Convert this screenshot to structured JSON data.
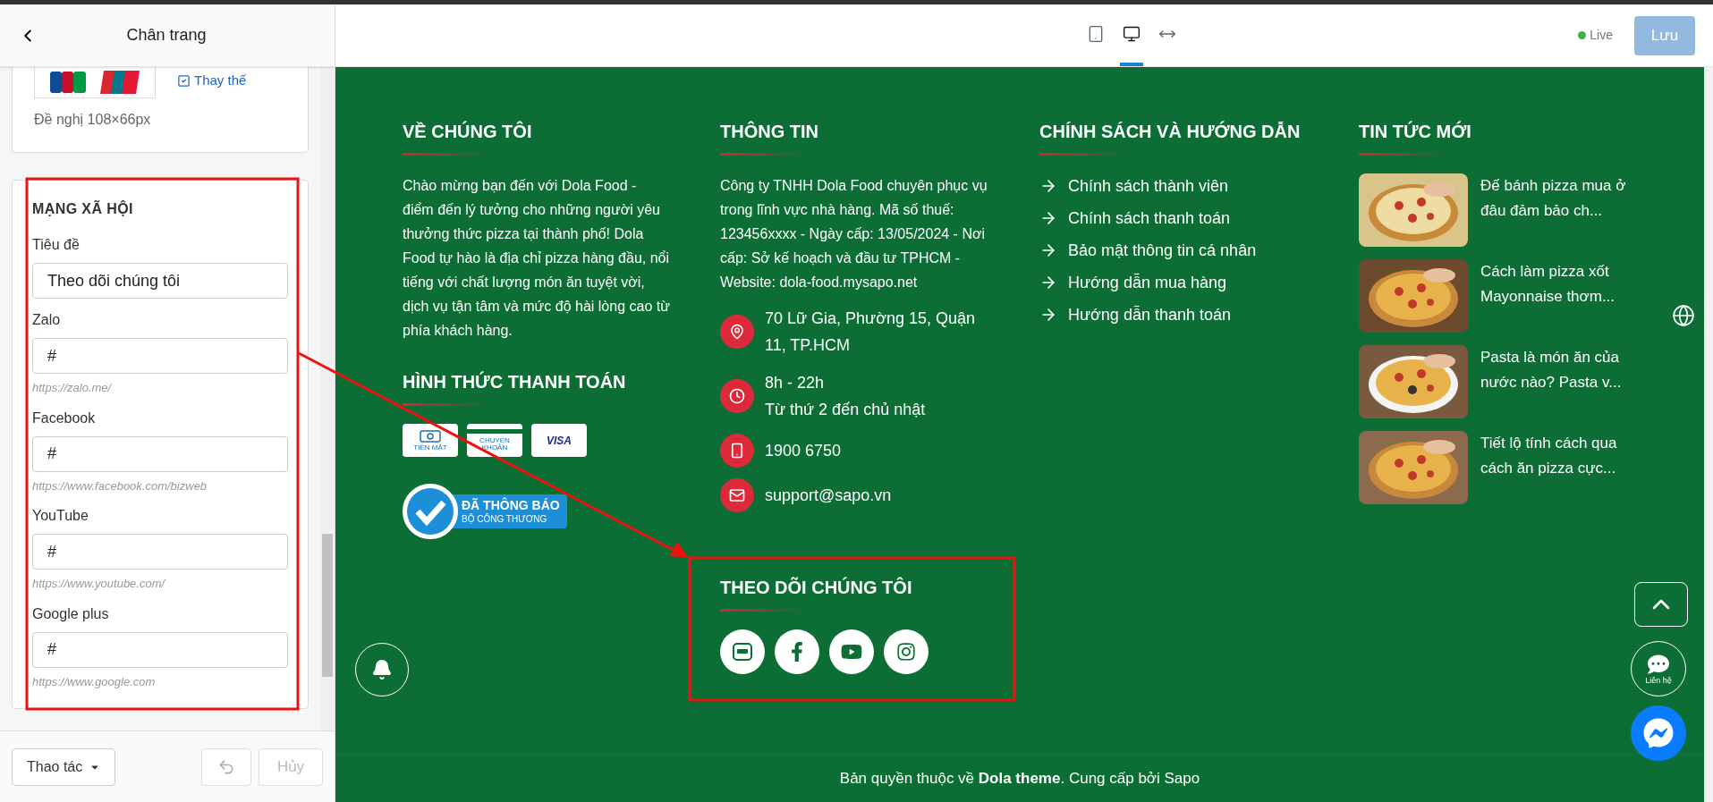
{
  "editor": {
    "title": "Chân trang"
  },
  "image_card": {
    "replace_link": "Thay thế",
    "hint": "Đề nghị 108×66px"
  },
  "social_settings": {
    "heading": "MẠNG XÃ HỘI",
    "fields": [
      {
        "label": "Tiêu đề",
        "value": "Theo dõi chúng tôi"
      },
      {
        "label": "Zalo",
        "value": "#",
        "hint": "https://zalo.me/"
      },
      {
        "label": "Facebook",
        "value": "#",
        "hint": "https://www.facebook.com/bizweb"
      },
      {
        "label": "YouTube",
        "value": "#",
        "hint": "https://www.youtube.com/"
      },
      {
        "label": "Google plus",
        "value": "#",
        "hint": "https://www.google.com"
      }
    ]
  },
  "actions": {
    "menu": "Thao tác",
    "undo": {
      "disabled": true
    },
    "cancel": {
      "label": "Hủy",
      "disabled": true
    }
  },
  "toolbar": {
    "devices": [
      {
        "kind": "tablet",
        "selected": false
      },
      {
        "kind": "desktop",
        "selected": true
      },
      {
        "kind": "fullwidth",
        "selected": false
      }
    ],
    "status": "Live",
    "save": {
      "label": "Lưu",
      "disabled": true
    }
  },
  "footer": {
    "about": {
      "heading": "VỀ CHÚNG TÔI",
      "text": "Chào mừng bạn đến với Dola Food - điểm đến lý tưởng cho những người yêu thưởng thức pizza tại thành phố! Dola Food tự hào là địa chỉ pizza hàng đầu, nổi tiếng với chất lượng món ăn tuyệt vời, dịch vụ tận tâm và mức độ hài lòng cao từ phía khách hàng."
    },
    "payment": {
      "heading": "HÌNH THỨC THANH TOÁN",
      "methods": [
        {
          "kind": "cash",
          "label": "TIỀN MẶT"
        },
        {
          "kind": "transfer",
          "label": "CHUYỂN KHOẢN"
        },
        {
          "kind": "card",
          "label": "VISA"
        }
      ],
      "certification": {
        "title": "ĐÃ THÔNG BÁO",
        "subtitle": "BỘ CÔNG THƯƠNG"
      }
    },
    "info": {
      "heading": "THÔNG TIN",
      "text": "Công ty TNHH Dola Food chuyên phục vụ trong lĩnh vực nhà hàng. Mã số thuế: 123456xxxx - Ngày cấp: 13/05/2024 - Nơi cấp: Sở kế hoạch và đầu tư TPHCM - Website: dola-food.mysapo.net",
      "contacts": [
        {
          "kind": "address",
          "lines": [
            "70 Lữ Gia, Phường 15, Quận 11, TP.HCM"
          ]
        },
        {
          "kind": "hours",
          "lines": [
            "8h - 22h",
            "Từ thứ 2 đến chủ nhật"
          ]
        },
        {
          "kind": "phone",
          "lines": [
            "1900 6750"
          ]
        },
        {
          "kind": "email",
          "lines": [
            "support@sapo.vn"
          ]
        }
      ]
    },
    "social": {
      "heading": "THEO DÕI CHÚNG TÔI",
      "networks": [
        {
          "kind": "zalo"
        },
        {
          "kind": "facebook"
        },
        {
          "kind": "youtube"
        },
        {
          "kind": "instagram"
        }
      ]
    },
    "policies": {
      "heading": "CHÍNH SÁCH VÀ HƯỚNG DẪN",
      "links": [
        "Chính sách thành viên",
        "Chính sách thanh toán",
        "Bảo mật thông tin cá nhân",
        "Hướng dẫn mua hàng",
        "Hướng dẫn thanh toán"
      ]
    },
    "news": {
      "heading": "TIN TỨC MỚI",
      "items": [
        {
          "title": "Đế bánh pizza mua ở đâu đảm bảo ch...",
          "kind": "picture"
        },
        {
          "title": "Cách làm pizza xốt Mayonnaise thơm...",
          "kind": "picture"
        },
        {
          "title": "Pasta là món ăn của nước nào? Pasta v...",
          "kind": "picture"
        },
        {
          "title": "Tiết lộ tính cách qua cách ăn pizza cực...",
          "kind": "picture"
        }
      ]
    },
    "copyright": "Bản quyền thuộc về **Dola theme**. Cung cấp bởi Sapo"
  },
  "floating": {
    "contact_label": "Liên hệ"
  }
}
